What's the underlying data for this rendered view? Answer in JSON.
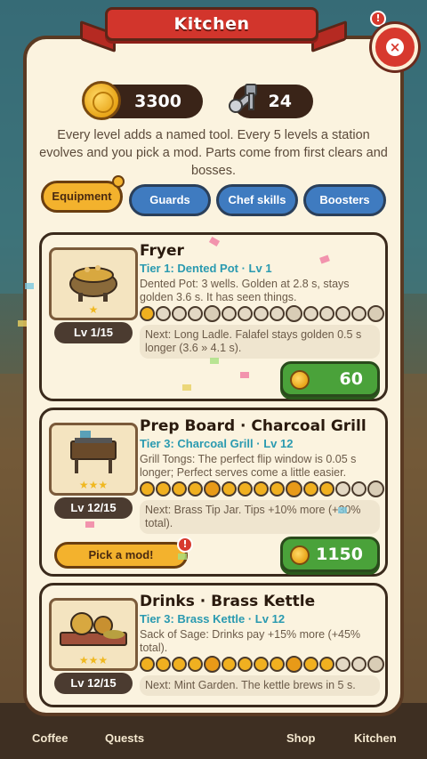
{
  "dialog": {
    "title": "Kitchen",
    "close_label": "×"
  },
  "currency": {
    "coins": "3300",
    "parts": "24"
  },
  "intro": "Every level adds a named tool. Every 5 levels a station evolves and you pick a mod. Parts come from first clears and bosses.",
  "tabs": [
    {
      "label": "Equipment",
      "active": true
    },
    {
      "label": "Guards",
      "active": false
    },
    {
      "label": "Chef skills",
      "active": false
    },
    {
      "label": "Boosters",
      "active": false
    }
  ],
  "stations": [
    {
      "title": "Fryer",
      "tier": "Tier 1: Dented Pot · Lv 1",
      "desc": "Dented Pot: 3 wells. Golden at 2.8 s, stays golden 3.6 s. It has seen things.",
      "level": "Lv 1/15",
      "stars": "★",
      "progress": 1,
      "next": "Next: Long Ladle. Falafel stays golden 0.5 s longer (3.6 » 4.1 s).",
      "cost": "60",
      "icon": "fryer-pot-icon"
    },
    {
      "title": "Prep Board · Charcoal Grill",
      "tier": "Tier 3: Charcoal Grill · Lv 12",
      "desc": "Grill Tongs: The perfect flip window is 0.05 s longer; Perfect serves come a little easier.",
      "level": "Lv 12/15",
      "stars": "★★★",
      "progress": 12,
      "next": "Next: Brass Tip Jar. Tips +10% more (+30% total).",
      "cost": "1150",
      "mod_label": "Pick a mod!",
      "icon": "charcoal-grill-icon"
    },
    {
      "title": "Drinks · Brass Kettle",
      "tier": "Tier 3: Brass Kettle · Lv 12",
      "desc": "Sack of Sage: Drinks pay +15% more (+45% total).",
      "level": "Lv 12/15",
      "stars": "★★★",
      "progress": 12,
      "next": "Next: Mint Garden. The kettle brews in 5 s.",
      "icon": "brass-kettle-icon"
    }
  ],
  "nav": {
    "coffee": "Coffee",
    "quests": "Quests",
    "shop": "Shop",
    "kitchen": "Kitchen"
  },
  "colors": {
    "accent": "#d2352c",
    "tab_blue": "#3f7bc0",
    "tab_active": "#f3b22d",
    "buy_green": "#4aa23a",
    "tier_teal": "#2a9ab0"
  }
}
